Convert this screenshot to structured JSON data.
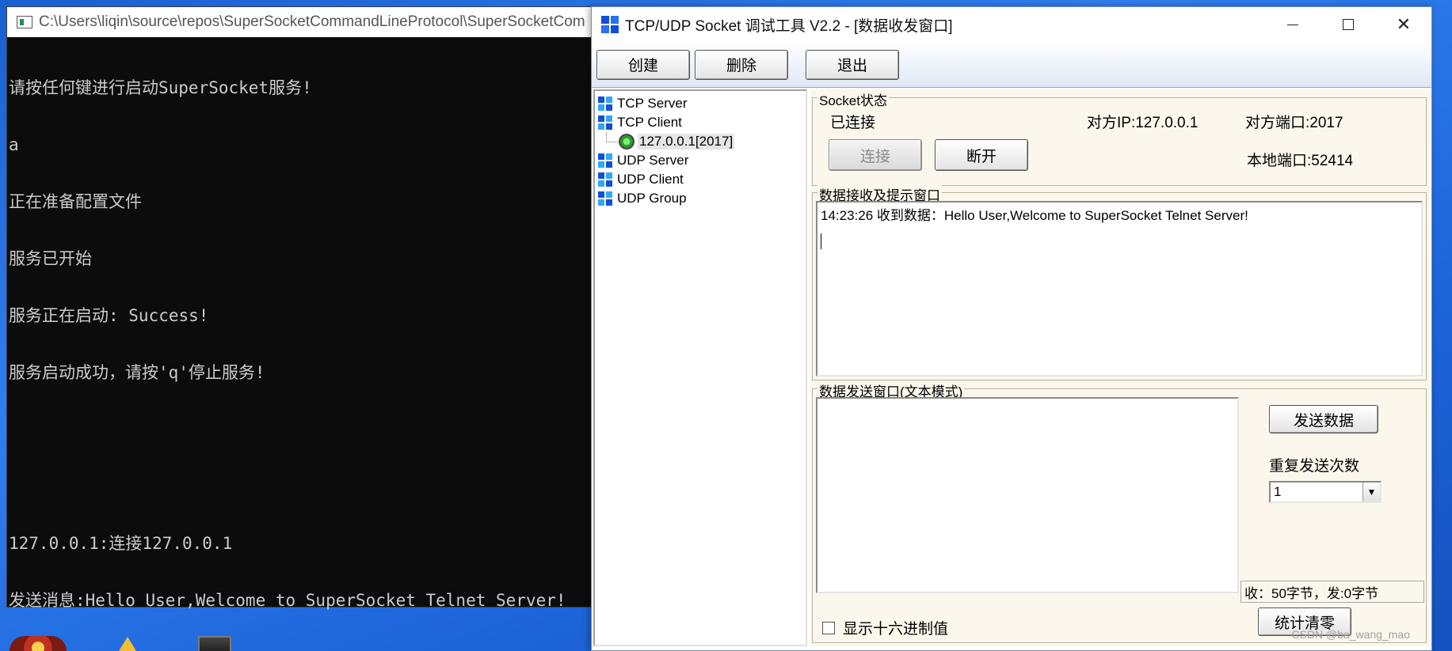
{
  "console": {
    "title": "C:\\Users\\liqin\\source\\repos\\SuperSocketCommandLineProtocol\\SuperSocketCom",
    "lines": [
      "请按任何键进行启动SuperSocket服务!",
      "a",
      "正在准备配置文件",
      "服务已开始",
      "服务正在启动: Success!",
      "服务启动成功，请按'q'停止服务!",
      "",
      "",
      "127.0.0.1:连接127.0.0.1",
      "发送消息:Hello User,Welcome to SuperSocket Telnet Server!"
    ]
  },
  "tool": {
    "title": "TCP/UDP Socket 调试工具 V2.2 - [数据收发窗口]",
    "window_controls": {
      "minimize": "—",
      "maximize": "☐",
      "close": "✕"
    },
    "toolbar": {
      "create": "创建",
      "delete": "删除",
      "exit": "退出"
    },
    "tree": {
      "tcp_server": "TCP Server",
      "tcp_client": "TCP Client",
      "connection": "127.0.0.1[2017]",
      "udp_server": "UDP Server",
      "udp_client": "UDP Client",
      "udp_group": "UDP Group"
    },
    "socket_status": {
      "legend": "Socket状态",
      "state": "已连接",
      "remote_ip": "对方IP:127.0.0.1",
      "remote_port": "对方端口:2017",
      "local_port": "本地端口:52414",
      "connect_label": "连接",
      "disconnect_label": "断开"
    },
    "receive": {
      "legend": "数据接收及提示窗口",
      "log": "14:23:26 收到数据：Hello User,Welcome to SuperSocket Telnet Server!"
    },
    "send": {
      "legend": "数据发送窗口(文本模式)",
      "send_label": "发送数据",
      "repeat_label": "重复发送次数",
      "repeat_value": "1",
      "counter": "收：50字节，发:0字节",
      "hex_label": "显示十六进制值",
      "clear_label": "统计清零"
    },
    "watermark": "CSDN @ba_wang_mao"
  },
  "colors": {
    "accent": "#1050d8",
    "desktop": "#1d64d8"
  }
}
